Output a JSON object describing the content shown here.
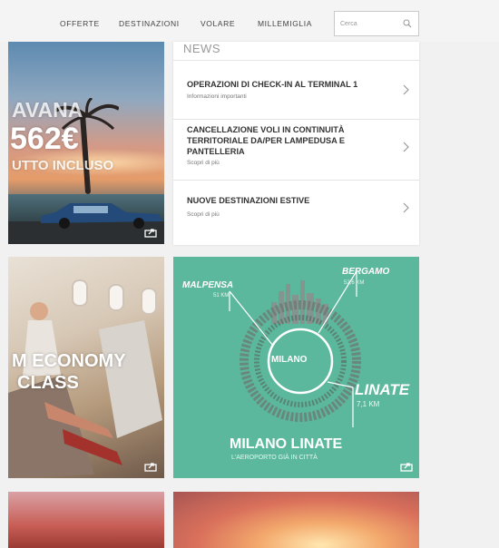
{
  "nav": {
    "items": [
      {
        "label": "OFFERTE"
      },
      {
        "label": "DESTINAZIONI"
      },
      {
        "label": "VOLARE"
      },
      {
        "label": "MILLEMIGLIA"
      }
    ],
    "search_placeholder": "Cerca",
    "search_icon": "magnifier-icon"
  },
  "havana": {
    "line1": "AVANA",
    "line2": "562€",
    "line3": "UTTO INCLUSO",
    "share_icon": "share-icon"
  },
  "news": {
    "title": "NEWS",
    "items": [
      {
        "title": "OPERAZIONI DI CHECK-IN AL TERMINAL 1",
        "subtitle": "Informazioni importanti"
      },
      {
        "title": "CANCELLAZIONE VOLI IN CONTINUITÀ TERRITORIALE DA/PER LAMPEDUSA E PANTELLERIA",
        "subtitle": "Scopri di più"
      },
      {
        "title": "NUOVE DESTINAZIONI ESTIVE",
        "subtitle": "Scopri di più"
      }
    ],
    "chevron_icon": "chevron-right-icon"
  },
  "premium": {
    "line1": "M ECONOMY",
    "line2": "CLASS"
  },
  "linate": {
    "malpensa": "MALPENSA",
    "malpensa_km": "51 KM",
    "bergamo": "BERGAMO",
    "bergamo_km": "52,6 KM",
    "milano": "MILANO",
    "linate": "LINATE",
    "linate_km": "7,1 KM",
    "headline": "MILANO LINATE",
    "subline": "L'AEROPORTO GIÀ IN CITTÀ"
  },
  "colors": {
    "linate_green": "#5cb89c",
    "nav_text": "#444444",
    "news_heading": "#333333"
  }
}
